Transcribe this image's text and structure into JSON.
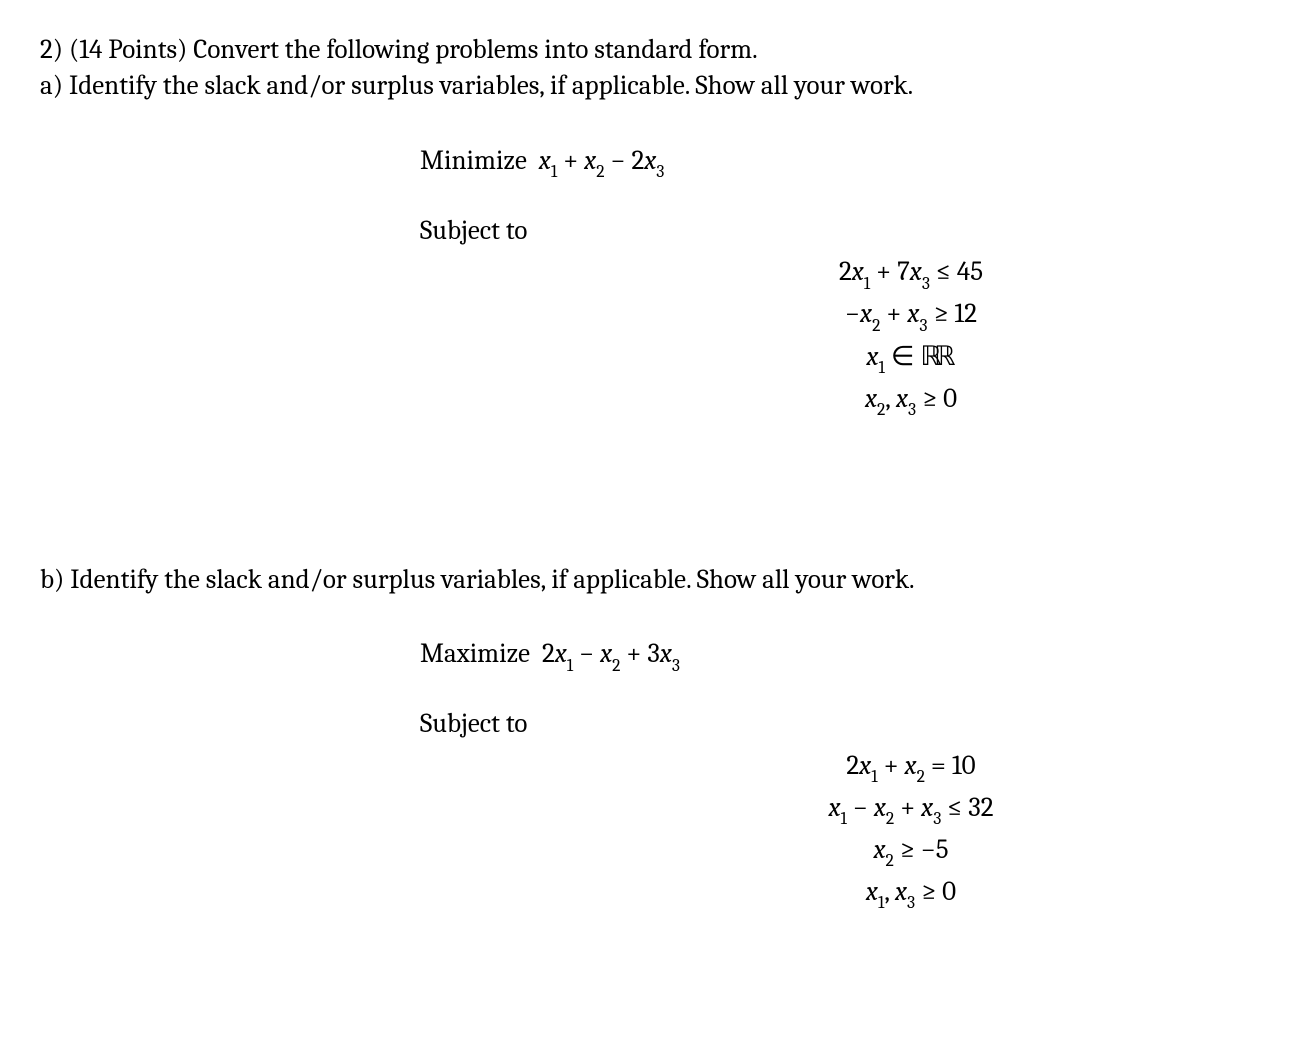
{
  "q_header": "2) (14 Points) Convert the following problems into standard form.",
  "part_a": {
    "intro": "a) Identify the slack and/or surplus variables, if applicable. Show all your work.",
    "objective_label": "Minimize",
    "objective_expr": "x₁ + x₂ − 2x₃",
    "subject_to": "Subject to",
    "constraints": [
      "2x₁ + 7x₃ ≤ 45",
      "−x₂ + x₃ ≥ 12",
      "x₁ ∈ ℝ",
      "x₂, x₃ ≥ 0"
    ]
  },
  "part_b": {
    "intro": "b) Identify the slack and/or surplus variables, if applicable. Show all your work.",
    "objective_label": "Maximize",
    "objective_expr": "2x₁ − x₂ + 3x₃",
    "subject_to": "Subject to",
    "constraints": [
      "2x₁ + x₂ = 10",
      "x₁ − x₂ + x₃ ≤ 32",
      "x₂ ≥ −5",
      "x₁, x₃ ≥ 0"
    ]
  }
}
